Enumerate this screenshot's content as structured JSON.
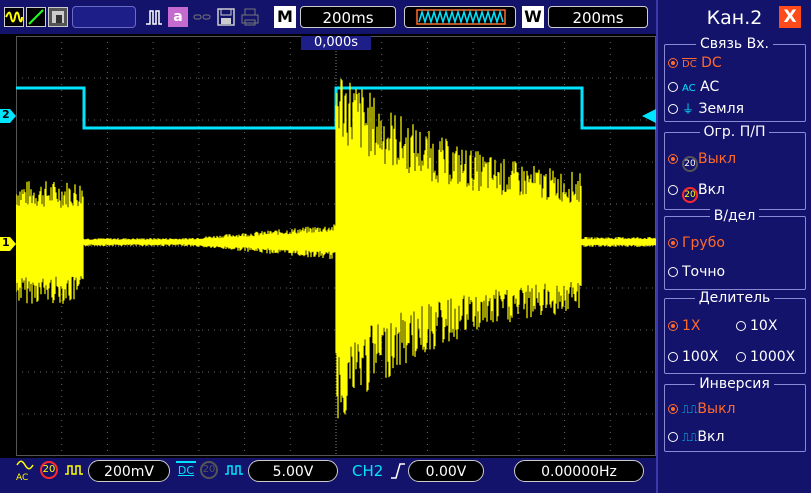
{
  "top": {
    "timebase": "200ms",
    "window_timebase": "200ms",
    "mode_label": "M",
    "window_label": "W",
    "trigger_letter": "a",
    "trigger_offset": "0,000s"
  },
  "bottom": {
    "ch1_coupling_label": "AC",
    "ch1_scale": "200mV",
    "ch2_coupling_label": "DC",
    "ch2_scale": "5.00V",
    "trigger_source": "CH2",
    "trigger_level": "0.00V",
    "frequency": "0.00000Hz"
  },
  "channel_markers": {
    "ch1": "1",
    "ch2": "2"
  },
  "menu": {
    "title": "Кан.2",
    "close": "X",
    "coupling": {
      "title": "Связь  Вх.",
      "options": [
        {
          "label": "DC",
          "icon": "DC",
          "selected": true
        },
        {
          "label": "AC",
          "icon": "AC",
          "selected": false
        },
        {
          "label": "Земля",
          "icon": "ground",
          "selected": false
        }
      ]
    },
    "bw_limit": {
      "title": "Огр.  П/П",
      "icon_text": "20",
      "options": [
        {
          "label": "Выкл",
          "selected": true
        },
        {
          "label": "Вкл",
          "selected": false
        }
      ]
    },
    "volts_div": {
      "title": "В/дел",
      "options": [
        {
          "label": "Грубо",
          "selected": true
        },
        {
          "label": "Точно",
          "selected": false
        }
      ]
    },
    "probe": {
      "title": "Делитель",
      "options": [
        {
          "label": "1X",
          "selected": true
        },
        {
          "label": "10X",
          "selected": false
        },
        {
          "label": "100X",
          "selected": false
        },
        {
          "label": "1000X",
          "selected": false
        }
      ]
    },
    "invert": {
      "title": "Инверсия",
      "options": [
        {
          "label": "Выкл",
          "selected": true
        },
        {
          "label": "Вкл",
          "selected": false
        }
      ]
    }
  },
  "colors": {
    "ch1": "#ffff00",
    "ch2": "#00e5ff",
    "selected": "#ff6a2a",
    "panel": "#13136b"
  }
}
